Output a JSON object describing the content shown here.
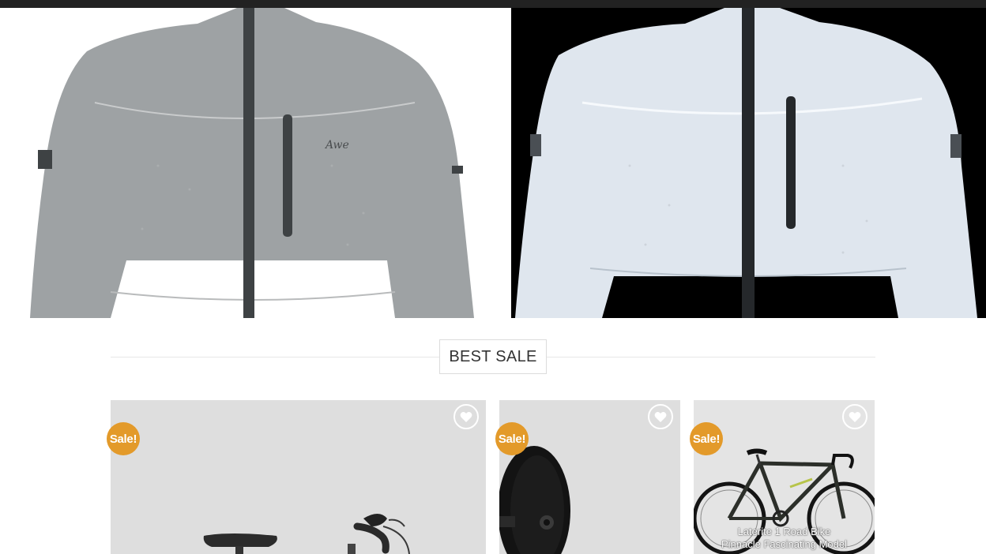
{
  "section": {
    "title": "BEST SALE"
  },
  "products": [
    {
      "sale_label": "Sale!"
    },
    {
      "sale_label": "Sale!"
    },
    {
      "sale_label": "Sale!",
      "caption_brand": "Laterite 1 Road Bike",
      "caption_sub": "Pinnacle Fascinating Model"
    }
  ],
  "icons": {
    "wishlist": "heart-icon"
  }
}
